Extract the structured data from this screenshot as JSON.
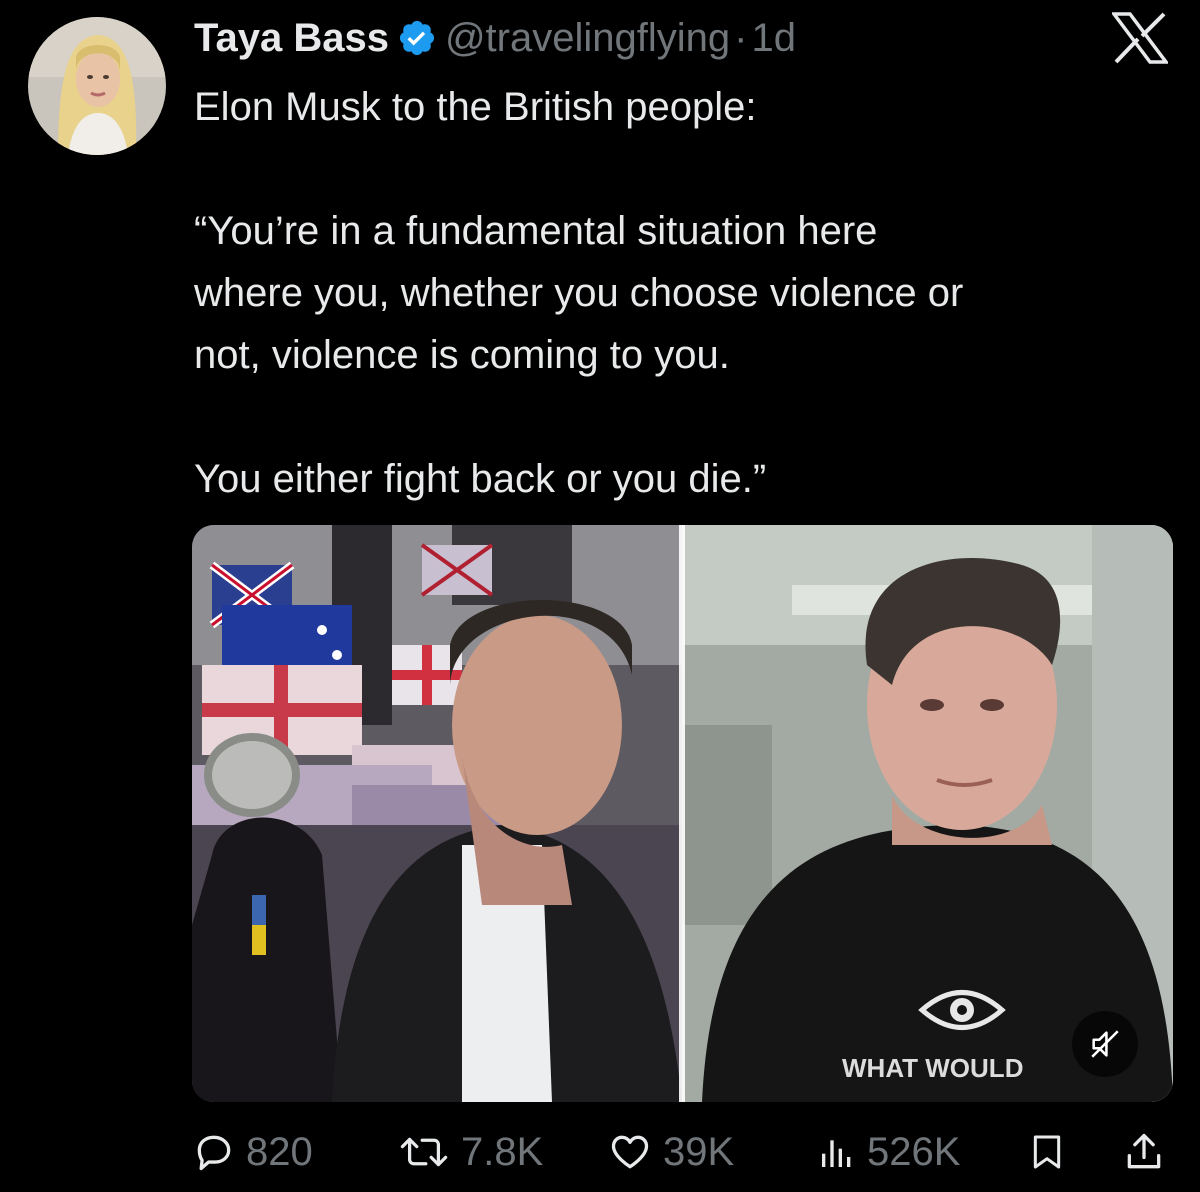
{
  "author": {
    "name": "Taya Bass",
    "handle": "@travelingflying",
    "separator": "·",
    "time": "1d",
    "avatar_icon": "profile-photo"
  },
  "tweet": {
    "line1": "Elon Musk to the British people:",
    "quote1": "“You’re in a fundamental situation here",
    "quote2": "where you, whether you choose violence or",
    "quote3": "not, violence is coming to you.",
    "quote4": "You either fight back or you die.”"
  },
  "media": {
    "shirt_text": "WHAT WOULD",
    "mute_icon": "speaker-muted-icon"
  },
  "actions": {
    "replies": "820",
    "reposts": "7.8K",
    "likes": "39K",
    "views": "526K"
  },
  "colors": {
    "background": "#000000",
    "text": "#e7e9ea",
    "muted": "#71767b",
    "verified": "#1d9bf0"
  }
}
